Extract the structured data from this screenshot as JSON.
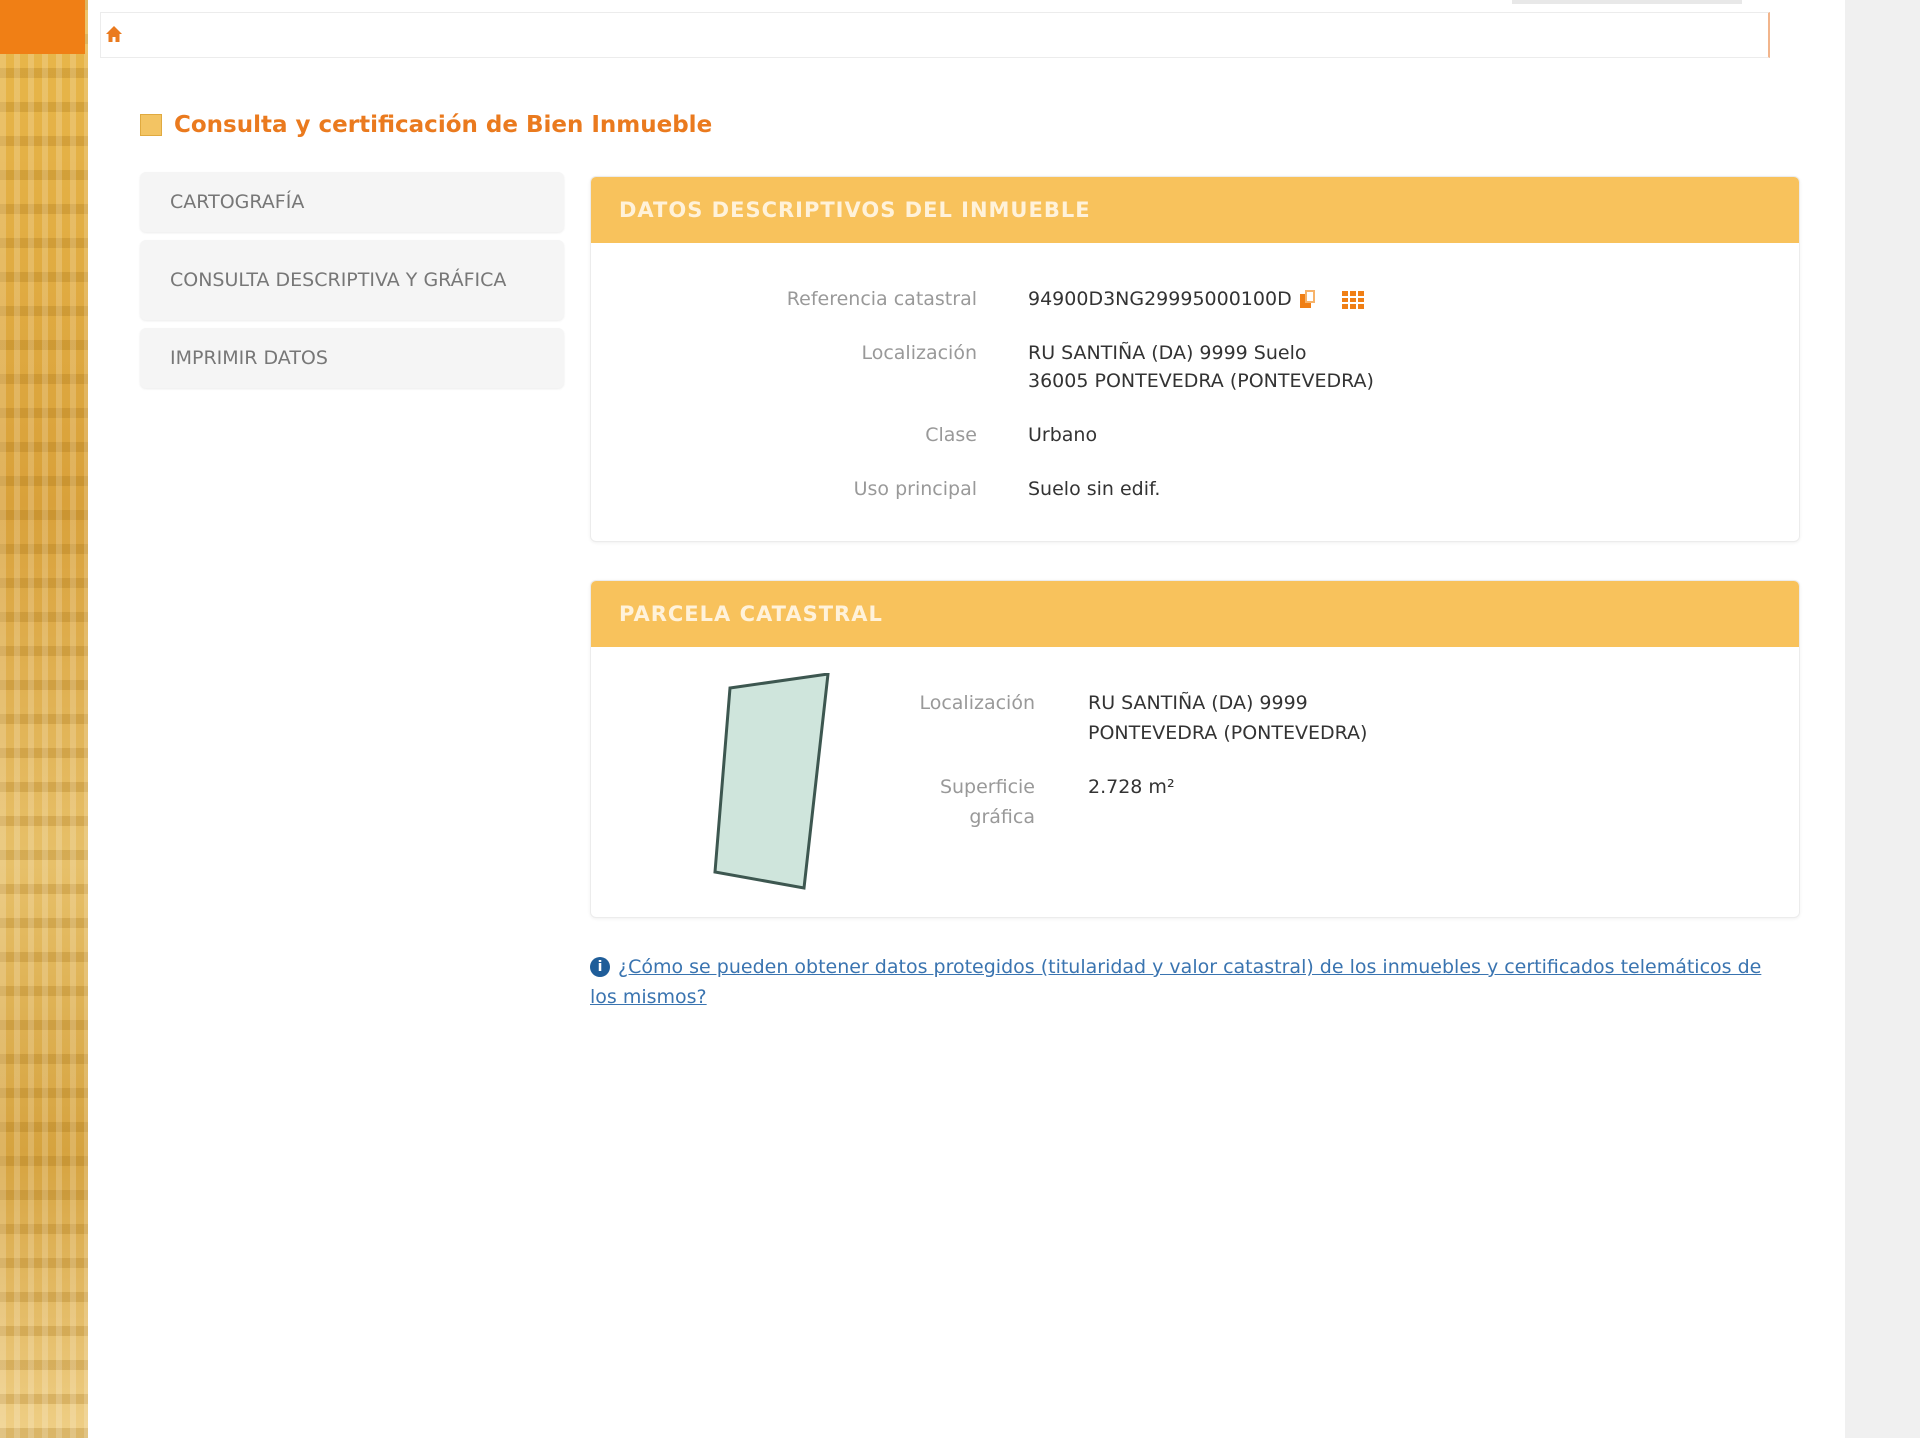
{
  "page": {
    "title": "Consulta y certificación de Bien Inmueble"
  },
  "menu": {
    "items": [
      {
        "label": "CARTOGRAFÍA"
      },
      {
        "label": "CONSULTA DESCRIPTIVA Y GRÁFICA"
      },
      {
        "label": "IMPRIMIR DATOS"
      }
    ]
  },
  "panel_descriptivos": {
    "header": "DATOS DESCRIPTIVOS DEL INMUEBLE",
    "fields": {
      "referencia": {
        "label": "Referencia catastral",
        "value": "94900D3NG29995000100D"
      },
      "localizacion": {
        "label": "Localización",
        "value_line1": "RU SANTIÑA (DA) 9999 Suelo",
        "value_line2": "36005 PONTEVEDRA (PONTEVEDRA)"
      },
      "clase": {
        "label": "Clase",
        "value": "Urbano"
      },
      "uso": {
        "label": "Uso principal",
        "value": "Suelo sin edif."
      }
    },
    "icons": [
      "copy-icon",
      "grid-icon"
    ]
  },
  "panel_parcela": {
    "header": "PARCELA CATASTRAL",
    "fields": {
      "localizacion": {
        "label": "Localización",
        "value_line1": "RU SANTIÑA (DA) 9999",
        "value_line2": "PONTEVEDRA (PONTEVEDRA)"
      },
      "superficie": {
        "label_line1": "Superficie",
        "label_line2": "gráfica",
        "value": "2.728 m²"
      }
    },
    "parcel_fill": "#cfe5dc",
    "parcel_stroke": "#3d5750"
  },
  "help": {
    "icon": "info-icon",
    "text": "¿Cómo se pueden obtener datos protegidos (titularidad y valor catastral) de los inmuebles y certificados telemáticos de los mismos?"
  },
  "colors": {
    "accent_orange": "#ea7a1e",
    "panel_header": "#f8c25c",
    "link_blue": "#3a74b0"
  }
}
